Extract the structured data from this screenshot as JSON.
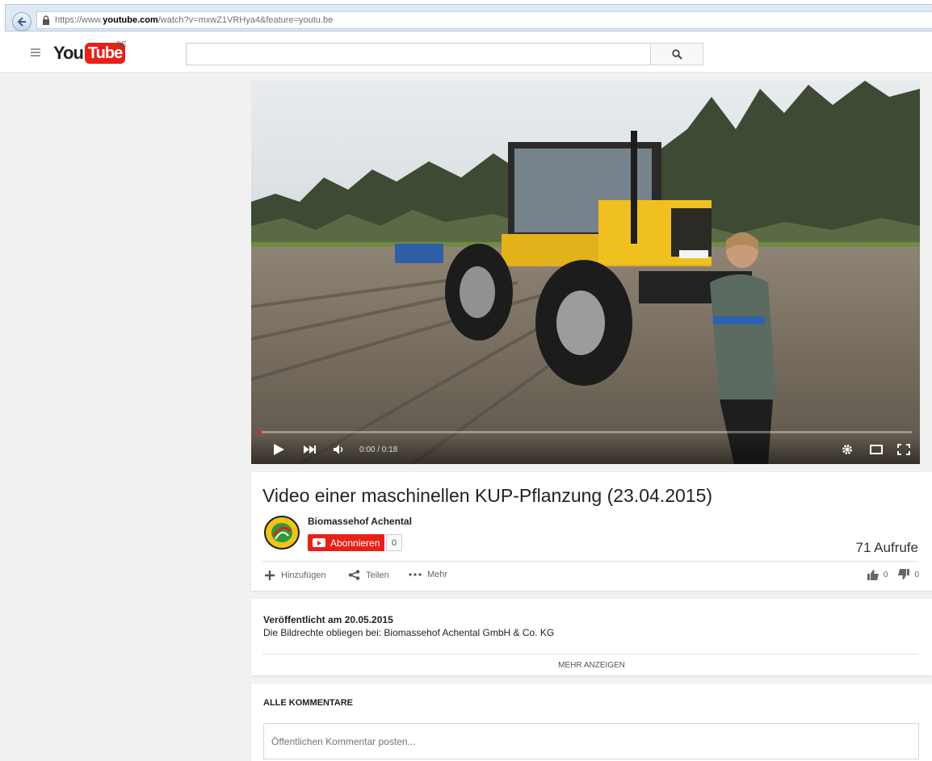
{
  "browser": {
    "url_scheme": "https://www.",
    "url_domain": "youtube.com",
    "url_path": "/watch?v=mxwZ1VRHya4&feature=youtu.be"
  },
  "header": {
    "logo_you": "You",
    "logo_tube": "Tube",
    "region": "DE",
    "search_value": "",
    "search_placeholder": ""
  },
  "player": {
    "time": "0:00 / 0:18",
    "progress": 0.0,
    "accent_color": "#e62117"
  },
  "video": {
    "title": "Video einer maschinellen KUP-Pflanzung (23.04.2015)",
    "channel": "Biomassehof Achental",
    "subscribe_label": "Abonnieren",
    "subscriber_count": "0",
    "views": "71 Aufrufe",
    "actions": {
      "add": "Hinzufügen",
      "share": "Teilen",
      "more": "Mehr"
    },
    "likes": "0",
    "dislikes": "0"
  },
  "description": {
    "published": "Veröffentlicht am 20.05.2015",
    "rights": "Die Bildrechte obliegen bei: Biomassehof Achental GmbH & Co. KG",
    "show_more": "MEHR ANZEIGEN"
  },
  "comments": {
    "title": "ALLE KOMMENTARE",
    "placeholder": "Öffentlichen Kommentar posten..."
  }
}
